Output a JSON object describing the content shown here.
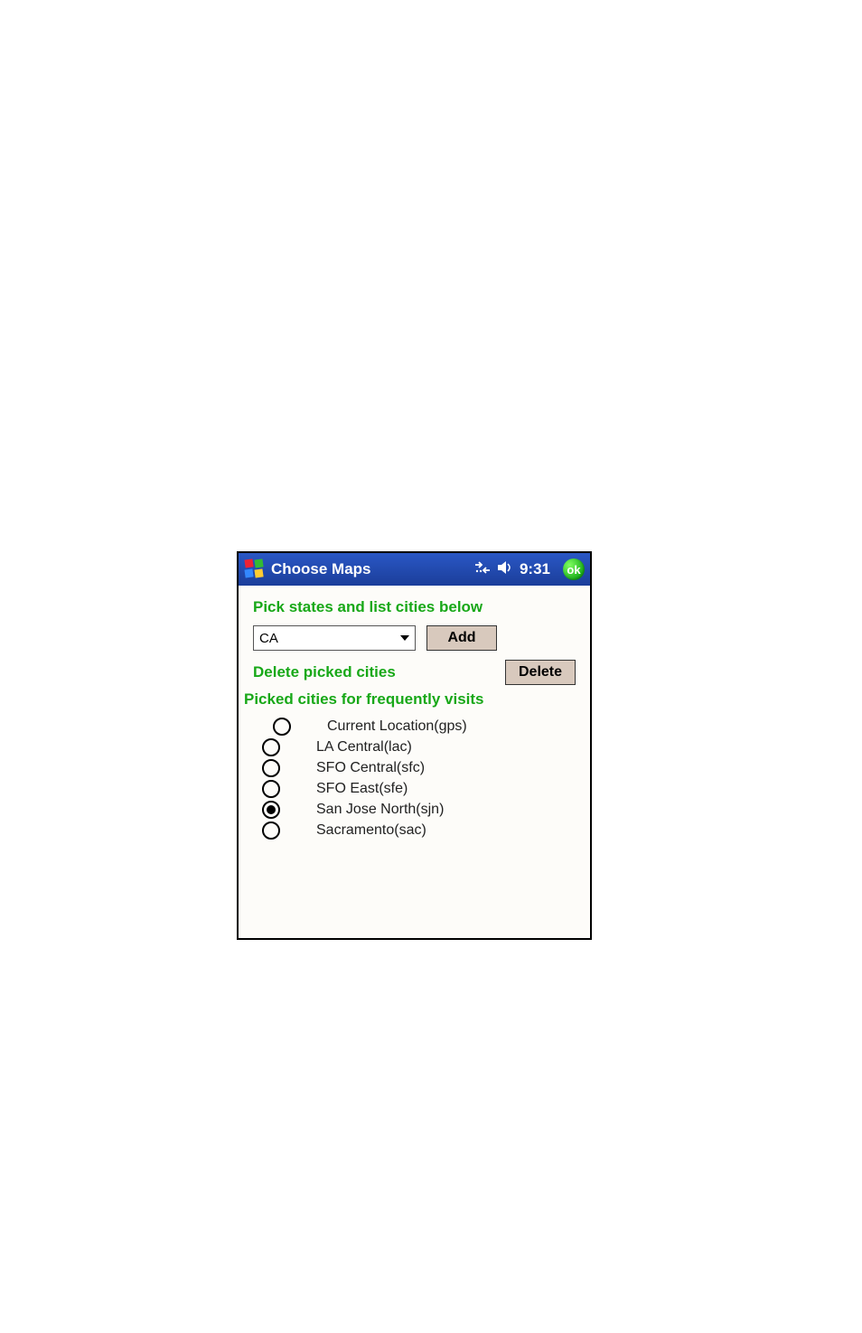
{
  "titlebar": {
    "title": "Choose Maps",
    "time": "9:31",
    "ok": "ok"
  },
  "headings": {
    "pick": "Pick states and list cities below",
    "delete": "Delete picked cities",
    "picked": "Picked cities for frequently visits"
  },
  "state_select": {
    "value": "CA"
  },
  "buttons": {
    "add": "Add",
    "delete": "Delete"
  },
  "cities": [
    {
      "label": "Current Location(gps)",
      "selected": false,
      "indent": true
    },
    {
      "label": "LA Central(lac)",
      "selected": false,
      "indent": false
    },
    {
      "label": "SFO Central(sfc)",
      "selected": false,
      "indent": false
    },
    {
      "label": "SFO East(sfe)",
      "selected": false,
      "indent": false
    },
    {
      "label": "San Jose North(sjn)",
      "selected": true,
      "indent": false
    },
    {
      "label": "Sacramento(sac)",
      "selected": false,
      "indent": false
    }
  ]
}
